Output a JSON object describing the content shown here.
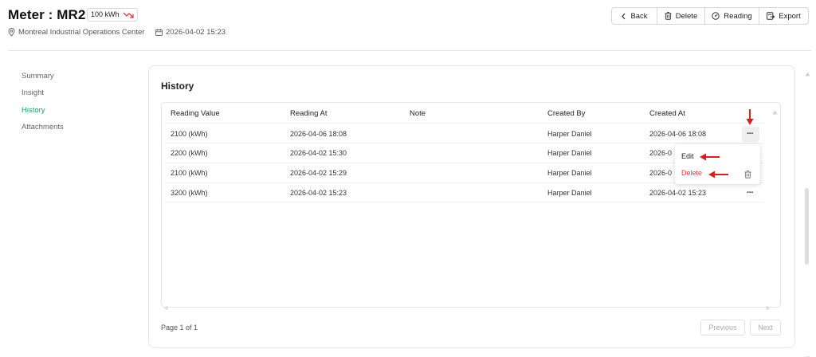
{
  "header": {
    "title": "Meter : MR2",
    "badge": "100 kWh",
    "location": "Montreal Industrial Operations Center",
    "datetime": "2026-04-02 15:23"
  },
  "toolbar": {
    "back": "Back",
    "delete": "Delete",
    "reading": "Reading",
    "export": "Export"
  },
  "sidebar": {
    "items": [
      {
        "label": "Summary"
      },
      {
        "label": "Insight"
      },
      {
        "label": "History"
      },
      {
        "label": "Attachments"
      }
    ]
  },
  "history": {
    "title": "History",
    "columns": [
      "Reading Value",
      "Reading At",
      "Note",
      "Created By",
      "Created At"
    ],
    "rows": [
      {
        "value": "2100 (kWh)",
        "at": "2026-04-06 18:08",
        "note": "",
        "by": "Harper Daniel",
        "created": "2026-04-06 18:08"
      },
      {
        "value": "2200 (kWh)",
        "at": "2026-04-02 15:30",
        "note": "",
        "by": "Harper Daniel",
        "created": "2026-0"
      },
      {
        "value": "2100 (kWh)",
        "at": "2026-04-02 15:29",
        "note": "",
        "by": "Harper Daniel",
        "created": "2026-0"
      },
      {
        "value": "3200 (kWh)",
        "at": "2026-04-02 15:23",
        "note": "",
        "by": "Harper Daniel",
        "created": "2026-04-02 15:23"
      }
    ],
    "row_menu": {
      "edit": "Edit",
      "delete": "Delete"
    },
    "more_glyph": "···"
  },
  "pagination": {
    "text": "Page 1 of 1",
    "previous": "Previous",
    "next": "Next"
  },
  "colors": {
    "accent": "#1e9a6d",
    "danger": "#e5393b",
    "annotation": "#d62020"
  }
}
